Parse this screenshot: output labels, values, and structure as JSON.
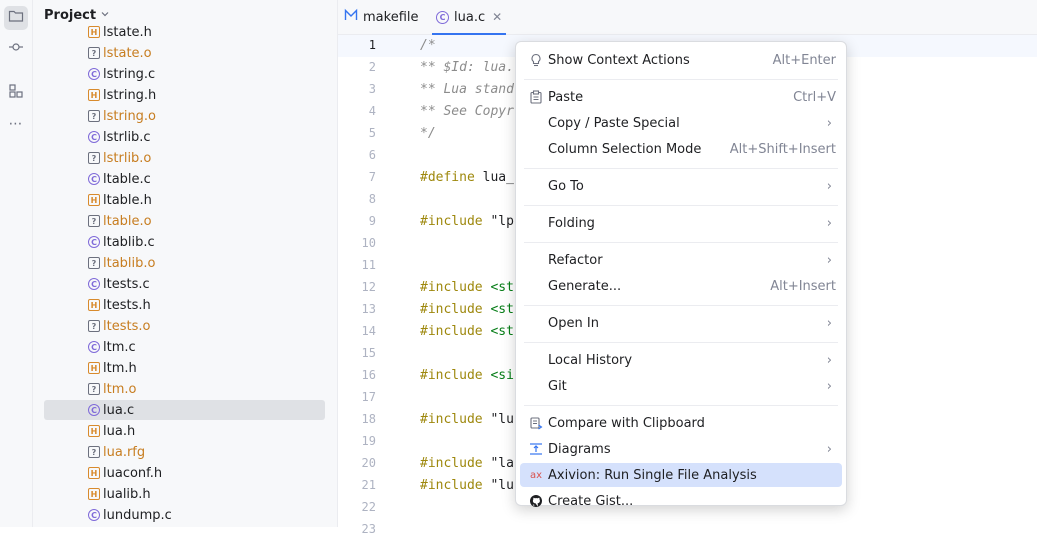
{
  "sidebar": {
    "items": [
      {
        "name": "project-tool-button",
        "icon": "folder-icon",
        "active": true
      },
      {
        "name": "commit-tool-button",
        "icon": "commit-icon",
        "active": false
      },
      {
        "name": "structure-tool-button",
        "icon": "structure-icon",
        "active": false
      },
      {
        "name": "more-tool-button",
        "icon": "more-icon",
        "active": false
      }
    ]
  },
  "project_panel": {
    "title": "Project",
    "files": [
      {
        "name": "lstate.h",
        "type": "h"
      },
      {
        "name": "lstate.o",
        "type": "o"
      },
      {
        "name": "lstring.c",
        "type": "c"
      },
      {
        "name": "lstring.h",
        "type": "h"
      },
      {
        "name": "lstring.o",
        "type": "o"
      },
      {
        "name": "lstrlib.c",
        "type": "c"
      },
      {
        "name": "lstrlib.o",
        "type": "o"
      },
      {
        "name": "ltable.c",
        "type": "c"
      },
      {
        "name": "ltable.h",
        "type": "h"
      },
      {
        "name": "ltable.o",
        "type": "o"
      },
      {
        "name": "ltablib.c",
        "type": "c"
      },
      {
        "name": "ltablib.o",
        "type": "o"
      },
      {
        "name": "ltests.c",
        "type": "c"
      },
      {
        "name": "ltests.h",
        "type": "h"
      },
      {
        "name": "ltests.o",
        "type": "o"
      },
      {
        "name": "ltm.c",
        "type": "c"
      },
      {
        "name": "ltm.h",
        "type": "h"
      },
      {
        "name": "ltm.o",
        "type": "o"
      },
      {
        "name": "lua.c",
        "type": "c",
        "selected": true
      },
      {
        "name": "lua.h",
        "type": "h"
      },
      {
        "name": "lua.rfg",
        "type": "o"
      },
      {
        "name": "luaconf.h",
        "type": "h"
      },
      {
        "name": "lualib.h",
        "type": "h"
      },
      {
        "name": "lundump.c",
        "type": "c"
      }
    ]
  },
  "tabs": [
    {
      "label": "makefile",
      "icon": "makefile-icon",
      "active": false
    },
    {
      "label": "lua.c",
      "icon": "c-file-icon",
      "active": true,
      "closable": true
    }
  ],
  "editor": {
    "current_line": 1,
    "lines": [
      {
        "n": "1",
        "kind": "comment",
        "text": "/*"
      },
      {
        "n": "2",
        "kind": "comment",
        "text": "** $Id: lua."
      },
      {
        "n": "3",
        "kind": "comment",
        "text": "** Lua stand"
      },
      {
        "n": "4",
        "kind": "comment",
        "text": "** See Copyr"
      },
      {
        "n": "5",
        "kind": "comment",
        "text": "*/"
      },
      {
        "n": "6",
        "kind": "blank",
        "text": ""
      },
      {
        "n": "7",
        "kind": "kw",
        "kw": "#define",
        "rest": " lua_"
      },
      {
        "n": "8",
        "kind": "blank",
        "text": ""
      },
      {
        "n": "9",
        "kind": "kw",
        "kw": "#include",
        "rest": " \"lp"
      },
      {
        "n": "10",
        "kind": "blank",
        "text": ""
      },
      {
        "n": "11",
        "kind": "blank",
        "text": ""
      },
      {
        "n": "12",
        "kind": "kw",
        "kw": "#include",
        "rest": " <st"
      },
      {
        "n": "13",
        "kind": "kw",
        "kw": "#include",
        "rest": " <st"
      },
      {
        "n": "14",
        "kind": "kw",
        "kw": "#include",
        "rest": " <st"
      },
      {
        "n": "15",
        "kind": "blank",
        "text": ""
      },
      {
        "n": "16",
        "kind": "kw",
        "kw": "#include",
        "rest": " <si"
      },
      {
        "n": "17",
        "kind": "blank",
        "text": ""
      },
      {
        "n": "18",
        "kind": "kw",
        "kw": "#include",
        "rest": " \"lu"
      },
      {
        "n": "19",
        "kind": "blank",
        "text": ""
      },
      {
        "n": "20",
        "kind": "kw",
        "kw": "#include",
        "rest": " \"la"
      },
      {
        "n": "21",
        "kind": "kw",
        "kw": "#include",
        "rest": " \"lu"
      },
      {
        "n": "22",
        "kind": "blank",
        "text": ""
      },
      {
        "n": "23",
        "kind": "blank",
        "text": ""
      }
    ]
  },
  "context_menu": {
    "items": [
      {
        "label": "Show Context Actions",
        "shortcut": "Alt+Enter",
        "icon": "bulb-icon",
        "name": "show-context-actions"
      },
      {
        "sep": true
      },
      {
        "label": "Paste",
        "shortcut": "Ctrl+V",
        "icon": "paste-icon",
        "name": "paste"
      },
      {
        "label": "Copy / Paste Special",
        "submenu": true,
        "name": "copy-paste-special"
      },
      {
        "label": "Column Selection Mode",
        "shortcut": "Alt+Shift+Insert",
        "name": "column-selection-mode"
      },
      {
        "sep": true
      },
      {
        "label": "Go To",
        "submenu": true,
        "name": "go-to"
      },
      {
        "sep": true
      },
      {
        "label": "Folding",
        "submenu": true,
        "name": "folding"
      },
      {
        "sep": true
      },
      {
        "label": "Refactor",
        "submenu": true,
        "name": "refactor"
      },
      {
        "label": "Generate...",
        "shortcut": "Alt+Insert",
        "name": "generate"
      },
      {
        "sep": true
      },
      {
        "label": "Open In",
        "submenu": true,
        "name": "open-in"
      },
      {
        "sep": true
      },
      {
        "label": "Local History",
        "submenu": true,
        "name": "local-history"
      },
      {
        "label": "Git",
        "submenu": true,
        "name": "git"
      },
      {
        "sep": true
      },
      {
        "label": "Compare with Clipboard",
        "icon": "compare-icon",
        "name": "compare-with-clipboard"
      },
      {
        "label": "Diagrams",
        "icon": "diagram-icon",
        "submenu": true,
        "name": "diagrams"
      },
      {
        "label": "Axivion: Run Single File Analysis",
        "icon": "axivion-icon",
        "highlighted": true,
        "name": "axivion-run-analysis"
      },
      {
        "label": "Create Gist...",
        "icon": "github-icon",
        "name": "create-gist"
      }
    ],
    "arrow_glyph": "›",
    "axivion_icon_text": "ax"
  },
  "colors": {
    "accent": "#3574f0",
    "menu_highlight": "#d5e1fc",
    "keyword": "#9e880d",
    "comment": "#8c8c8c",
    "c_icon": "#7f6ad9",
    "h_icon": "#d88a2c"
  }
}
